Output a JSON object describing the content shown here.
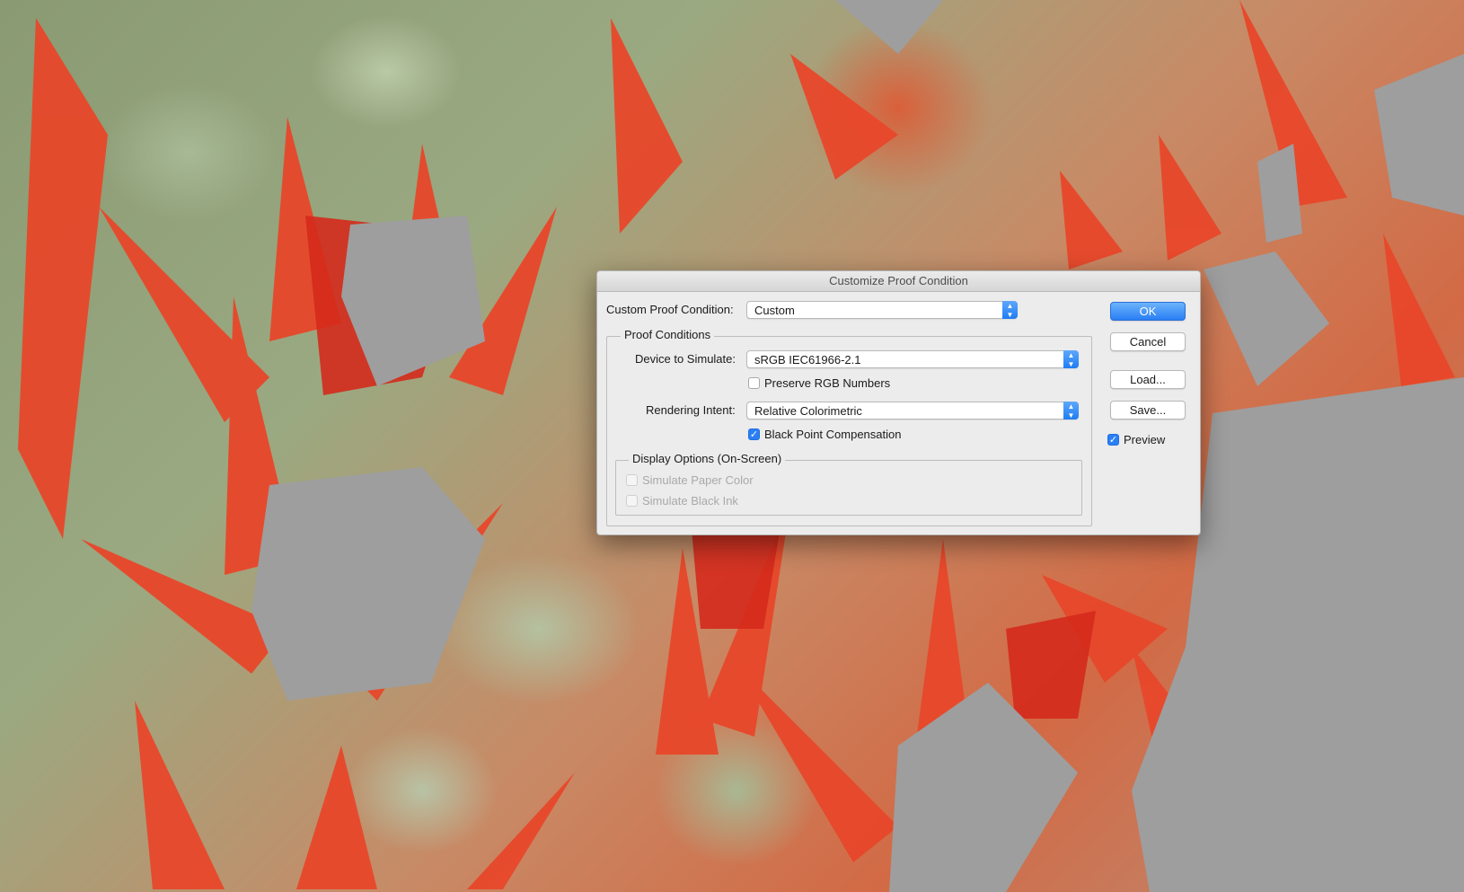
{
  "dialog": {
    "title": "Customize Proof Condition",
    "custom_proof_condition": {
      "label": "Custom Proof Condition:",
      "value": "Custom"
    },
    "proof_conditions": {
      "group_label": "Proof Conditions",
      "device": {
        "label": "Device to Simulate:",
        "value": "sRGB IEC61966-2.1"
      },
      "preserve_rgb": {
        "label": "Preserve RGB Numbers",
        "checked": false
      },
      "intent": {
        "label": "Rendering Intent:",
        "value": "Relative Colorimetric"
      },
      "black_point": {
        "label": "Black Point Compensation",
        "checked": true
      }
    },
    "display_options": {
      "group_label": "Display Options (On-Screen)",
      "paper_color": {
        "label": "Simulate Paper Color",
        "checked": false,
        "enabled": false
      },
      "black_ink": {
        "label": "Simulate Black Ink",
        "checked": false,
        "enabled": false
      }
    },
    "buttons": {
      "ok": "OK",
      "cancel": "Cancel",
      "load": "Load...",
      "save": "Save..."
    },
    "preview": {
      "label": "Preview",
      "checked": true
    }
  },
  "icons": {
    "checkmark": "✓",
    "stepper": "⌃⌄"
  },
  "colors": {
    "accent": "#2a7ff5",
    "dialog_bg": "#ececec",
    "gamut_warning": "#9e9e9e"
  }
}
